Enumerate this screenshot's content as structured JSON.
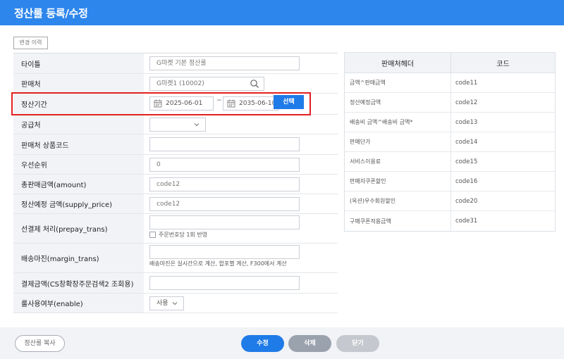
{
  "window": {
    "title": "정산룰 등록/수정"
  },
  "history_button": "변경 이력",
  "form": {
    "title_label": "타이틀",
    "title_value": "G마켓 기본 정산룰",
    "seller_label": "판매처",
    "seller_value": "G마켓1 (10002)",
    "period_label": "정산기간",
    "period_start": "2025-06-01",
    "period_sep": "~",
    "period_end": "2035-06-10",
    "period_select_btn": "선택",
    "supplier_label": "공급처",
    "supplier_value": "",
    "product_code_label": "판매처 상품코드",
    "product_code_value": "",
    "priority_label": "우선순위",
    "priority_value": "0",
    "amount_label": "총판매금액(amount)",
    "amount_value": "code12",
    "supply_label": "정산예정 금액(supply_price)",
    "supply_value": "code12",
    "prepay_label": "선결제 처리(prepay_trans)",
    "prepay_value": "",
    "prepay_check_label": "주문번호당 1회 반영",
    "margin_label": "배송마진(margin_trans)",
    "margin_value": "",
    "margin_hint": "배송마진은 실시간으로 계산, 합포별 계산, F300에서 계산",
    "payment_label": "결제금액(CS창확장주문검색2 조회용)",
    "payment_value": "",
    "enable_label": "룰사용여부(enable)",
    "enable_value": "사용"
  },
  "codes": {
    "col_header": "판매처헤더",
    "col_code": "코드",
    "rows": [
      {
        "header": "금액^판매금액",
        "code": "code11"
      },
      {
        "header": "정산예정금액",
        "code": "code12"
      },
      {
        "header": "배송비 금액^배송비 금액*",
        "code": "code13"
      },
      {
        "header": "판매단가",
        "code": "code14"
      },
      {
        "header": "서비스이용료",
        "code": "code15"
      },
      {
        "header": "판매자쿠폰할인",
        "code": "code16"
      },
      {
        "header": "(옥션)우수회원할인",
        "code": "code20"
      },
      {
        "header": "구매쿠폰적용금액",
        "code": "code31"
      }
    ]
  },
  "footer": {
    "copy_button": "정산룰 복사",
    "edit_button": "수정",
    "delete_button": "삭제",
    "close_button": "닫기"
  },
  "colors": {
    "accent": "#1f7be8",
    "titlebar": "#2d86ec",
    "highlight": "#e32020"
  }
}
